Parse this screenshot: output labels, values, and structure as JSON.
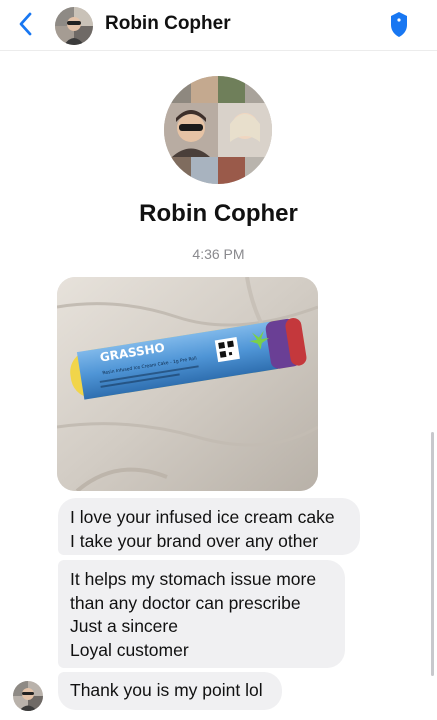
{
  "colors": {
    "accent": "#1877f2",
    "bubble": "#f0f0f2",
    "muted": "#8a8a8e"
  },
  "header": {
    "back_icon": "chevron-left-icon",
    "contact_name": "Robin Copher",
    "action_icon": "shield-icon"
  },
  "profile": {
    "name": "Robin Copher"
  },
  "timestamp": "4:36 PM",
  "attachment": {
    "product_brand": "GRASSHO",
    "product_subtext": "Resin Infused Ice Cream Cake - 1g Pre Roll"
  },
  "messages": [
    {
      "lines": [
        "I love your infused ice cream cake",
        "I take your brand over any other"
      ]
    },
    {
      "lines": [
        "It helps my stomach issue more",
        "than any doctor can prescribe",
        "Just a sincere",
        "Loyal customer"
      ]
    },
    {
      "lines": [
        "Thank you is my point lol"
      ]
    }
  ]
}
